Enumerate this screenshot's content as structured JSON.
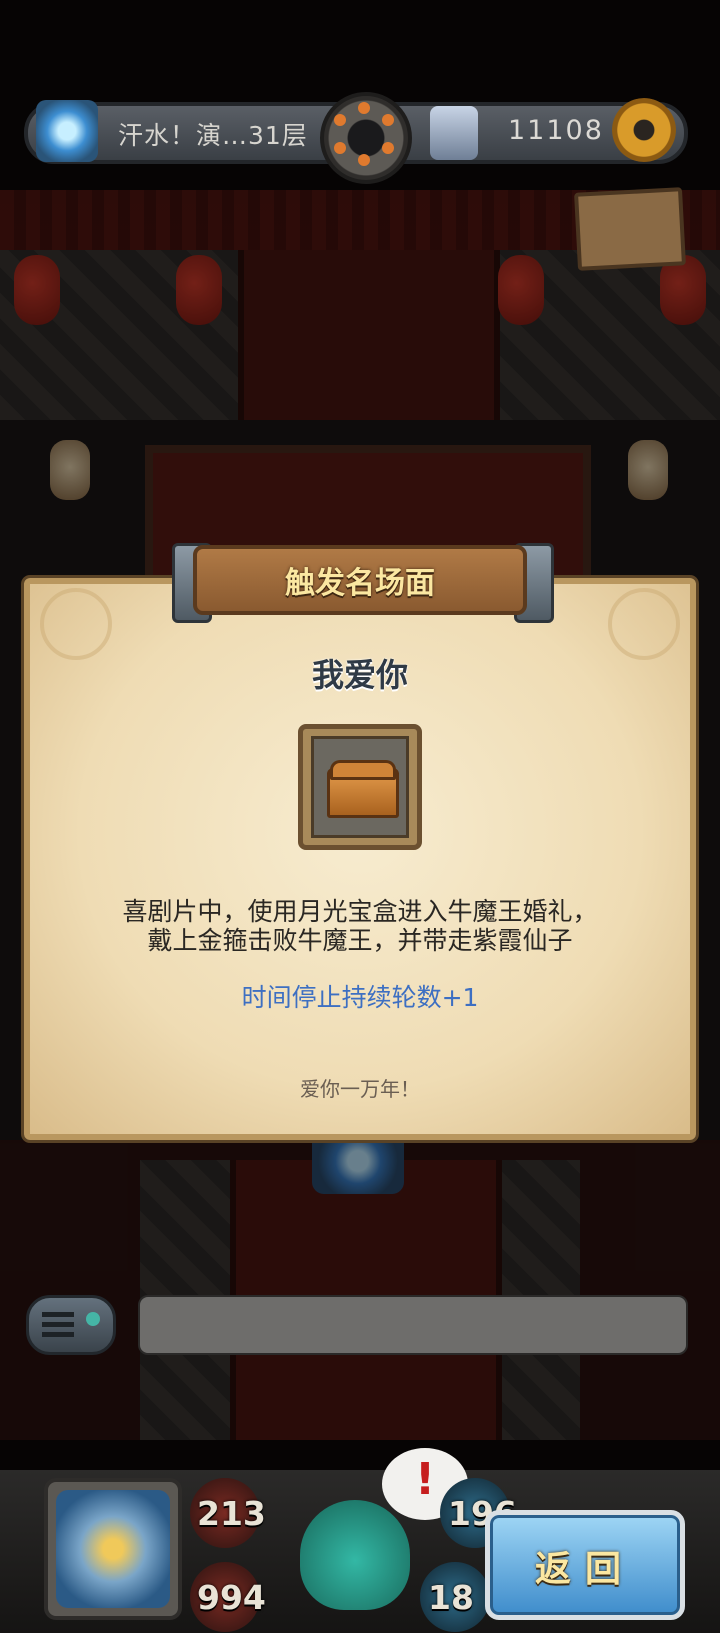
{
  "hud": {
    "level_title": "汗水！演…31层",
    "gold": "11108"
  },
  "modal": {
    "header": "触发名场面",
    "scene_name": "我爱你",
    "item_icon": "treasure-chest-icon",
    "description_line1": "喜剧片中，使用月光宝盒进入牛魔王婚礼，",
    "description_line2": "戴上金箍击败牛魔王，并带走紫霞仙子",
    "effect": "时间停止持续轮数+1",
    "quote": "爱你一万年！"
  },
  "chat": {
    "menu_icon": "chat-menu-icon",
    "message": ""
  },
  "bottom": {
    "stat_attack": "213",
    "stat_hp": "994",
    "stat_right_top": "196",
    "stat_right_bottom": "18",
    "alert": "!",
    "back_label": "返回"
  }
}
